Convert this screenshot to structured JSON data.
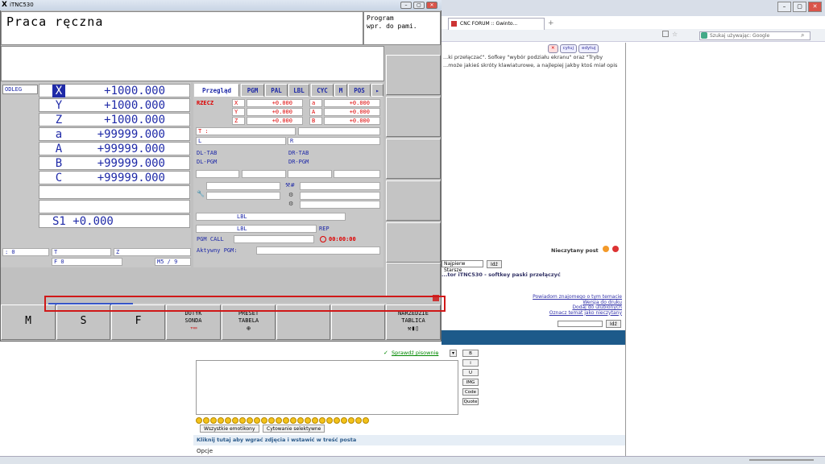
{
  "browser": {
    "tab_title": "CNC FORUM :: Gwinto...",
    "search_placeholder": "Szukaj używając: Google",
    "post_buttons": [
      "cytuj",
      "edytuj"
    ],
    "post_text": "...ki przełączać\". Sofkey \"wybór podziału ekranu\" oraz \"Tryby ...może jakieś skróty klawiaturowe, a najlepiej jakby ktoś miał opis",
    "unread_label": "Nieczytany post",
    "sort_value": "Najpierw Starsze",
    "go_label": "Idź",
    "topic_title": "...tor iTNC530 - softkey paski przełączyć",
    "links": [
      "Powiadom znajomego o tym temacie",
      "Wersja do druku",
      "Dodaj do ulubionych",
      "Oznacz temat jako nieczytany"
    ],
    "spellcheck": "Sprawdź pisownię",
    "format_buttons": [
      "B",
      "i",
      "U",
      "IMG",
      "Code",
      "Quote"
    ],
    "emoticons_button": "Wszystkie emotikony",
    "quote_button": "Cytowanie selektywne",
    "upload_link": "Kliknij tutaj aby wgrać zdjęcia i wstawić w treść posta",
    "options_label": "Opcje"
  },
  "itnc": {
    "window_title": "iTNC530",
    "mode": "Praca ręczna",
    "program_mode": [
      "Program",
      "wpr. do pami."
    ],
    "odleg": "ODLEG",
    "axes": [
      {
        "label": "X",
        "value": "+1000.000"
      },
      {
        "label": "Y",
        "value": "+1000.000"
      },
      {
        "label": "Z",
        "value": "+1000.000"
      },
      {
        "label": "a",
        "value": "+99999.000"
      },
      {
        "label": "A",
        "value": "+99999.000"
      },
      {
        "label": "B",
        "value": "+99999.000"
      },
      {
        "label": "C",
        "value": "+99999.000"
      }
    ],
    "spindle": "S1 +0.000",
    "status_T": "T",
    "status_Z": "Z",
    "status_F": "F 0",
    "status_M": "M5 / 9",
    "status_sym": ": 0",
    "tabs": [
      "Przegląd",
      "PGM",
      "PAL",
      "LBL",
      "CYC",
      "M",
      "POS"
    ],
    "rzecz": "RZECZ",
    "pos_rows": [
      {
        "a1": "X",
        "v1": "+0.000",
        "a2": "a",
        "v2": "+0.000"
      },
      {
        "a1": "Y",
        "v1": "+0.000",
        "a2": "A",
        "v2": "+0.000"
      },
      {
        "a1": "Z",
        "v1": "+0.000",
        "a2": "B",
        "v2": "+0.000"
      }
    ],
    "t_label": "T :",
    "l_label": "L",
    "r_label": "R",
    "dltab": "DL-TAB",
    "drtab": "DR-TAB",
    "dlpgm": "DL-PGM",
    "drpgm": "DR-PGM",
    "lbl1": "LBL",
    "lbl2": "LBL",
    "rep": "REP",
    "pgm_call": "PGM CALL",
    "timer": "00:00:00",
    "active_pgm": "Aktywny PGM:",
    "softkeys": [
      {
        "label": "M",
        "big": true
      },
      {
        "label": "S",
        "big": true
      },
      {
        "label": "F",
        "big": true
      },
      {
        "label": "DOTYK\nSONDA",
        "big": false
      },
      {
        "label": "PRESET\nTABELA",
        "big": false
      },
      {
        "label": "",
        "big": false
      },
      {
        "label": "",
        "big": false
      },
      {
        "label": "NARZEDZIE\nTABLICA",
        "big": false
      }
    ],
    "softkey_bar_progress": 0.25
  }
}
